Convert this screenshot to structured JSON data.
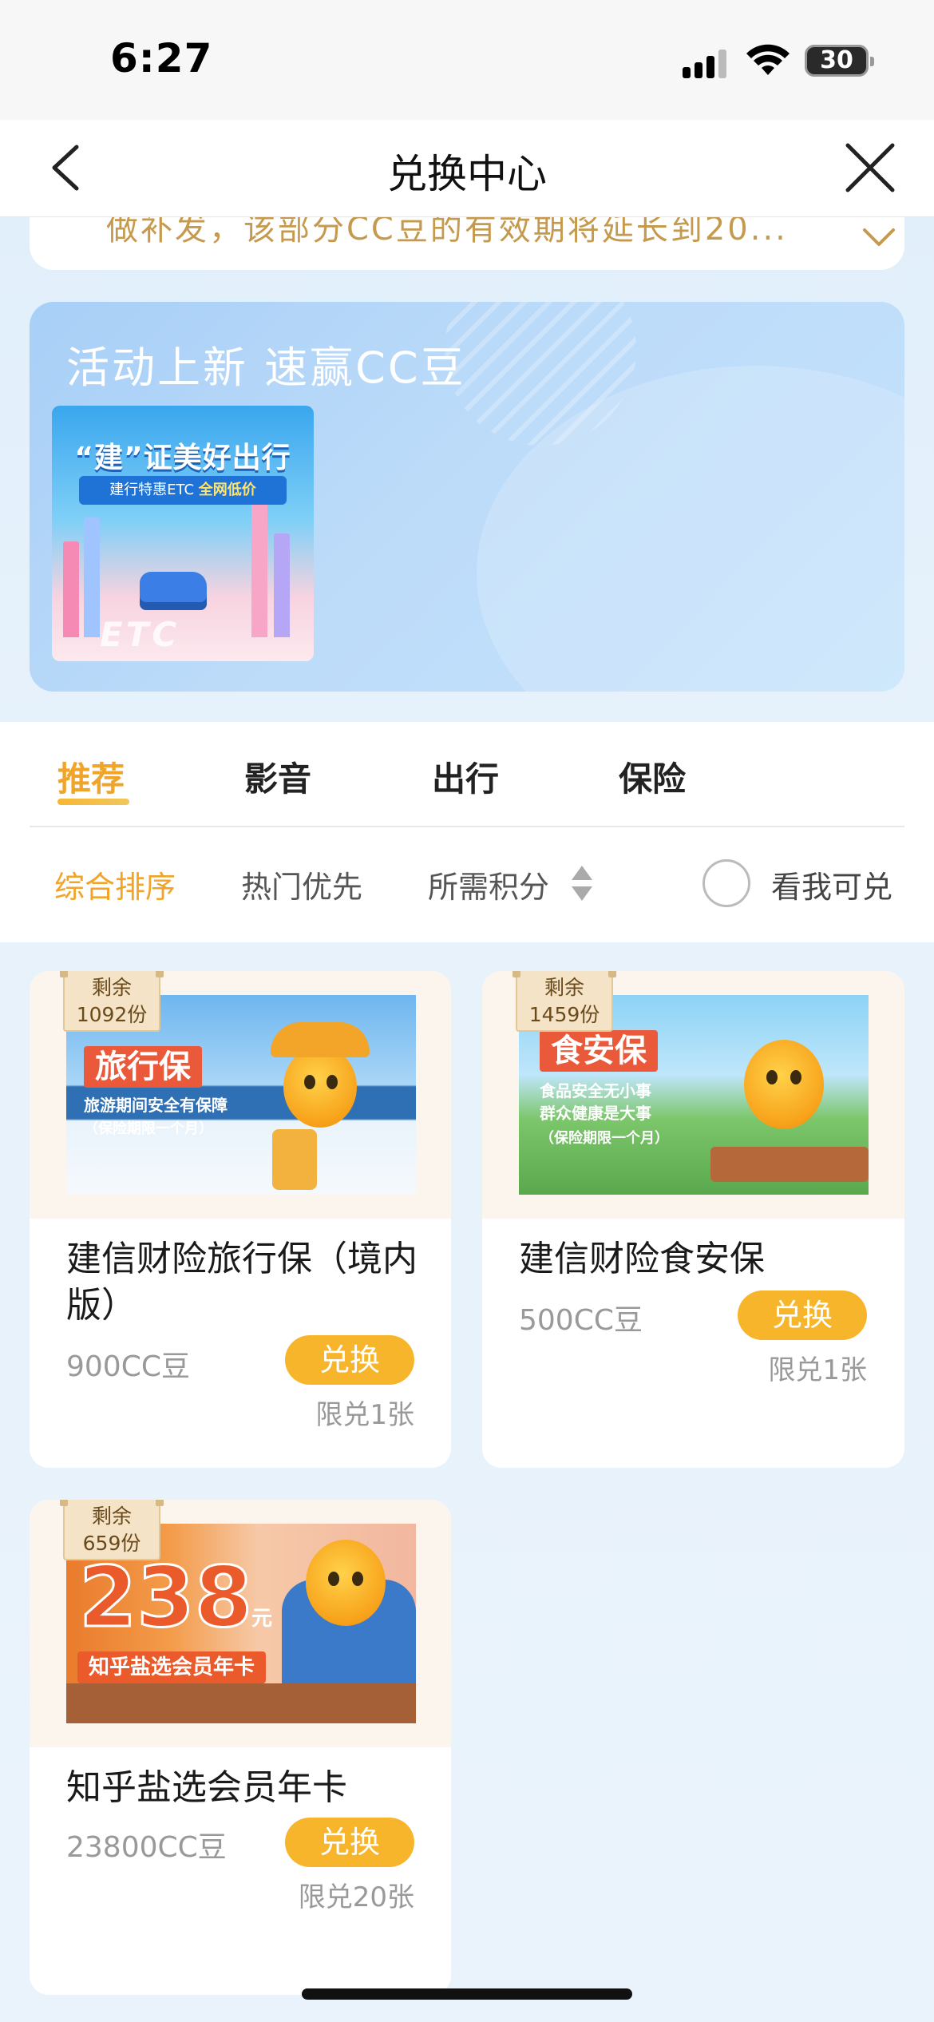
{
  "status_bar": {
    "time": "6:27",
    "battery": "30"
  },
  "nav": {
    "title": "兑换中心"
  },
  "notice": {
    "text": "做补发，该部分CC豆的有效期将延长到20..."
  },
  "activity": {
    "title": "活动上新 速赢CC豆",
    "card": {
      "headline": "“建”证美好出行",
      "ribbon_a": "建行特惠ETC ",
      "ribbon_b": "全网低价",
      "etc": "ETC"
    }
  },
  "tabs": [
    "推荐",
    "影音",
    "出行",
    "保险"
  ],
  "sort_options": [
    "综合排序",
    "热门优先",
    "所需积分"
  ],
  "filter": {
    "label": "看我可兑"
  },
  "products": [
    {
      "stock_label": "剩余",
      "stock": "1092份",
      "name": "建信财险旅行保（境内版）",
      "price": "900CC豆",
      "button": "兑换",
      "limit": "限兑1张",
      "image": {
        "banner": "旅行保",
        "line1": "旅游期间安全有保障",
        "line2": "（保险期限一个月）"
      }
    },
    {
      "stock_label": "剩余",
      "stock": "1459份",
      "name": "建信财险食安保",
      "price": "500CC豆",
      "button": "兑换",
      "limit": "限兑1张",
      "image": {
        "banner": "食安保",
        "line1": "食品安全无小事",
        "line2": "群众健康是大事",
        "line3": "（保险期限一个月）"
      }
    },
    {
      "stock_label": "剩余",
      "stock": "659份",
      "name": "知乎盐选会员年卡",
      "price": "23800CC豆",
      "button": "兑换",
      "limit": "限兑20张",
      "image": {
        "big_number": "238",
        "unit": "元",
        "banner": "知乎盐选会员年卡"
      }
    }
  ],
  "colors": {
    "accent": "#f0a42a",
    "button": "#f7b52c",
    "notice": "#c59a4e"
  }
}
